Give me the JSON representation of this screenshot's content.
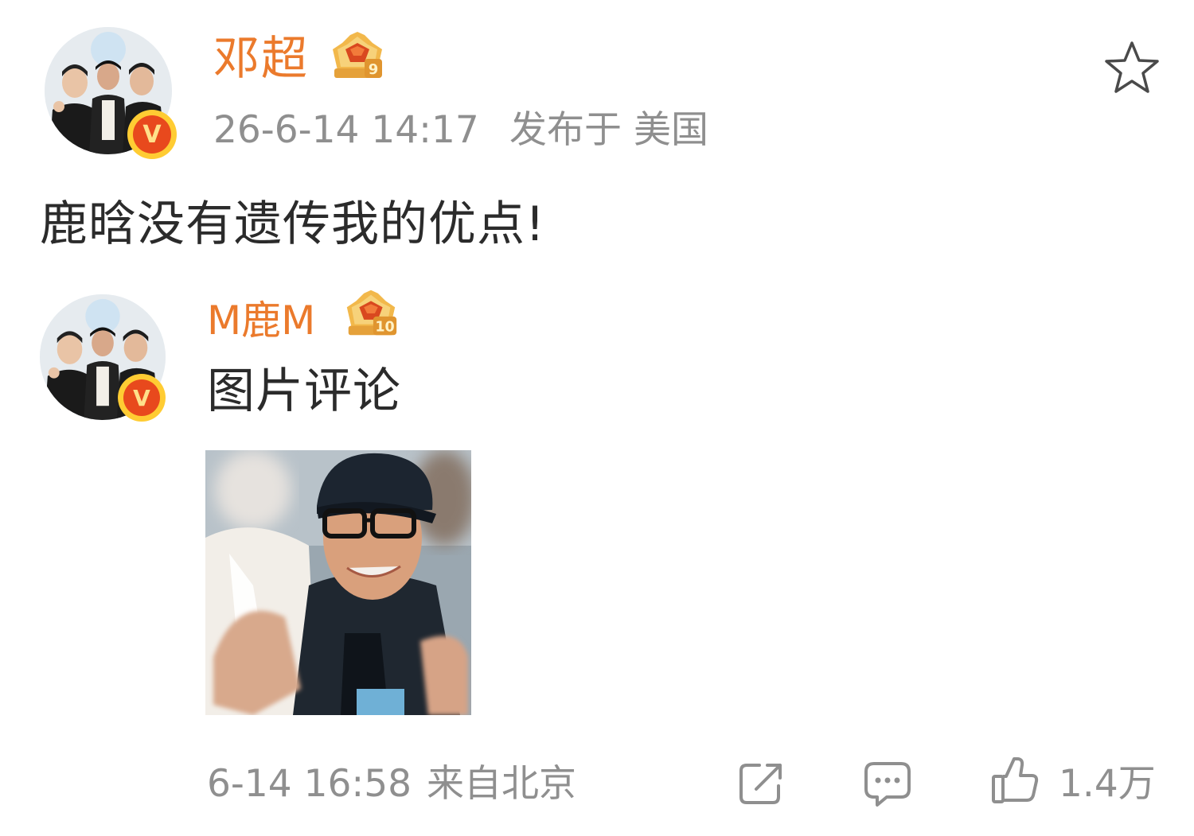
{
  "post": {
    "author": "邓超",
    "rank_level": "9",
    "timestamp": "26-6-14 14:17",
    "location": "发布于 美国",
    "text": "鹿晗没有遗传我的优点!",
    "verified_mark": "V"
  },
  "comment": {
    "author": "M鹿M",
    "rank_level": "10",
    "text": "图片评论",
    "timestamp": "6-14 16:58",
    "source": "来自北京",
    "verified_mark": "V",
    "likes": "1.4万"
  },
  "icons": {
    "favorite": "star-outline-icon",
    "share": "share-icon",
    "comment": "comment-icon",
    "like": "thumbs-up-icon"
  },
  "colors": {
    "username": "#eb7a2c",
    "meta": "#8f8f8f",
    "body": "#2b2b2b",
    "verified": "#e8491d"
  }
}
